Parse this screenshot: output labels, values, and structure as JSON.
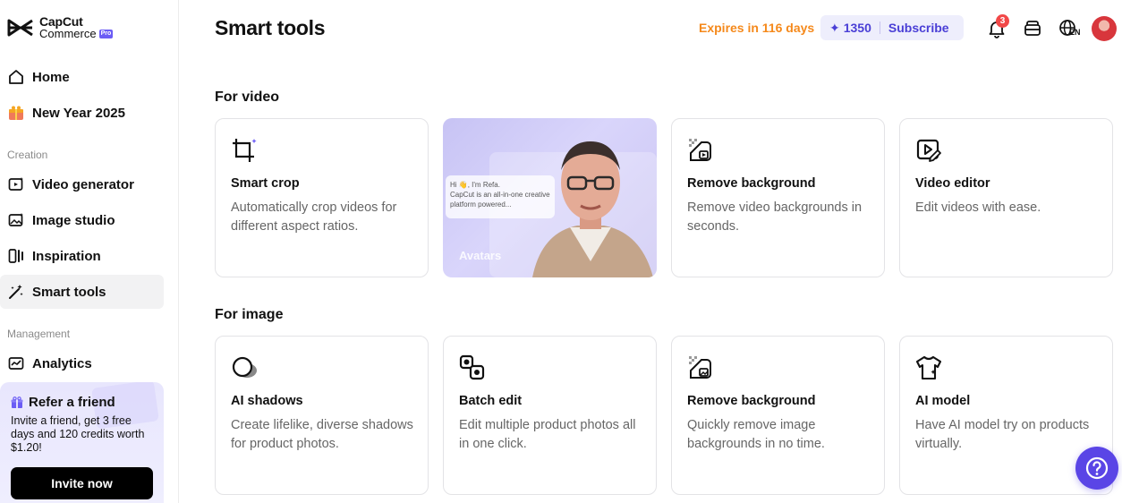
{
  "brand": {
    "line1": "CapCut",
    "line2": "Commerce",
    "badge": "Pro"
  },
  "sidebar": {
    "items": [
      {
        "label": "Home"
      },
      {
        "label": "New Year 2025"
      },
      {
        "label": "Video generator"
      },
      {
        "label": "Image studio"
      },
      {
        "label": "Inspiration"
      },
      {
        "label": "Smart tools"
      },
      {
        "label": "Analytics"
      }
    ],
    "sections": {
      "creation": "Creation",
      "management": "Management"
    },
    "refer": {
      "title": "Refer a friend",
      "description": "Invite a friend, get 3 free days and 120 credits worth $1.20!",
      "button": "Invite now"
    }
  },
  "header": {
    "title": "Smart tools",
    "expires": "Expires in 116 days",
    "credits": "1350",
    "subscribe": "Subscribe",
    "notifications": "3",
    "language": "EN"
  },
  "video": {
    "section": "For video",
    "cards": [
      {
        "title": "Smart crop",
        "desc": "Automatically crop videos for different aspect ratios."
      },
      {
        "label": "Avatars",
        "bubble_line1": "Hi 👋, I'm Refa.",
        "bubble_line2": "CapCut is an all-in-one creative platform powered..."
      },
      {
        "title": "Remove background",
        "desc": "Remove video backgrounds in seconds."
      },
      {
        "title": "Video editor",
        "desc": "Edit videos with ease."
      }
    ]
  },
  "image": {
    "section": "For image",
    "cards": [
      {
        "title": "AI shadows",
        "desc": "Create lifelike, diverse shadows for product photos."
      },
      {
        "title": "Batch edit",
        "desc": "Edit multiple product photos all in one click."
      },
      {
        "title": "Remove background",
        "desc": "Quickly remove image backgrounds in no time."
      },
      {
        "title": "AI model",
        "desc": "Have AI model try on products virtually."
      }
    ]
  },
  "colors": {
    "accent": "#5a45e6",
    "expires": "#f5891b",
    "badge": "#f24848"
  }
}
